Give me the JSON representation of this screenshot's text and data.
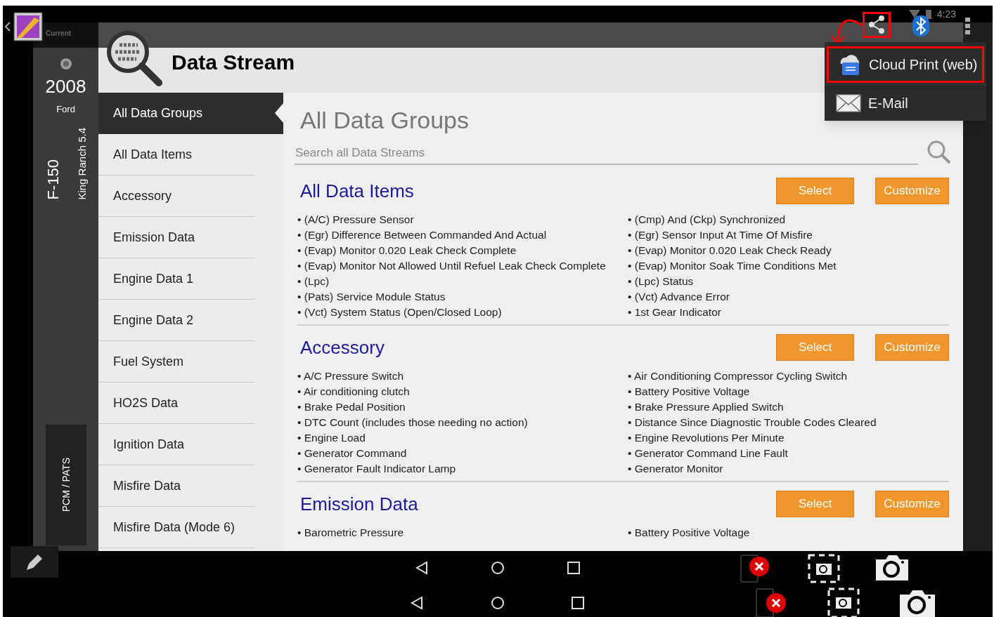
{
  "status_bar": {
    "recent_app_label": "Current",
    "time": "4:23"
  },
  "vehicle": {
    "year": "2008",
    "make": "Ford",
    "model": "F-150",
    "trim": "King Ranch 5.4",
    "module": "PCM / PATS"
  },
  "header": {
    "title": "Data Stream"
  },
  "nav": {
    "items": [
      {
        "label": "All Data Groups",
        "selected": true
      },
      {
        "label": "All Data Items",
        "selected": false
      },
      {
        "label": "Accessory",
        "selected": false
      },
      {
        "label": "Emission Data",
        "selected": false
      },
      {
        "label": "Engine Data 1",
        "selected": false
      },
      {
        "label": "Engine Data 2",
        "selected": false
      },
      {
        "label": "Fuel System",
        "selected": false
      },
      {
        "label": "HO2S Data",
        "selected": false
      },
      {
        "label": "Ignition Data",
        "selected": false
      },
      {
        "label": "Misfire Data",
        "selected": false
      },
      {
        "label": "Misfire Data (Mode 6)",
        "selected": false
      }
    ]
  },
  "content": {
    "title": "All Data Groups",
    "search_placeholder": "Search all Data Streams",
    "groups": [
      {
        "title": "All Data Items",
        "select_label": "Select",
        "customize_label": "Customize",
        "items_left": [
          "• (A/C) Pressure Sensor",
          "• (Egr) Difference Between Commanded And Actual",
          "• (Evap) Monitor 0.020 Leak Check Complete",
          "• (Evap) Monitor Not Allowed Until Refuel Leak Check Complete",
          "• (Lpc)",
          "• (Pats) Service Module Status",
          "• (Vct) System Status (Open/Closed Loop)"
        ],
        "items_right": [
          "• (Cmp) And (Ckp) Synchronized",
          "• (Egr) Sensor Input At Time Of Misfire",
          "• (Evap) Monitor 0.020 Leak Check Ready",
          "• (Evap) Monitor Soak Time Conditions Met",
          "• (Lpc) Status",
          "• (Vct) Advance Error",
          "• 1st Gear Indicator"
        ]
      },
      {
        "title": "Accessory",
        "select_label": "Select",
        "customize_label": "Customize",
        "items_left": [
          "• A/C Pressure Switch",
          "• Air conditioning clutch",
          "• Brake Pedal Position",
          "• DTC Count (includes those needing no action)",
          "• Engine Load",
          "• Generator Command",
          "• Generator Fault Indicator Lamp"
        ],
        "items_right": [
          "• Air Conditioning Compressor Cycling Switch",
          "• Battery Positive Voltage",
          "• Brake Pressure Applied Switch",
          "• Distance Since Diagnostic Trouble Codes Cleared",
          "• Engine Revolutions Per Minute",
          "• Generator Command Line Fault",
          "• Generator Monitor"
        ]
      },
      {
        "title": "Emission Data",
        "select_label": "Select",
        "customize_label": "Customize",
        "items_left": [
          "• Barometric Pressure"
        ],
        "items_right": [
          "• Battery Positive Voltage"
        ]
      }
    ]
  },
  "share_menu": {
    "items": [
      {
        "label": "Cloud Print (web)",
        "kind": "cloud_print",
        "highlighted": true
      },
      {
        "label": "E-Mail",
        "kind": "email",
        "highlighted": false
      }
    ]
  }
}
